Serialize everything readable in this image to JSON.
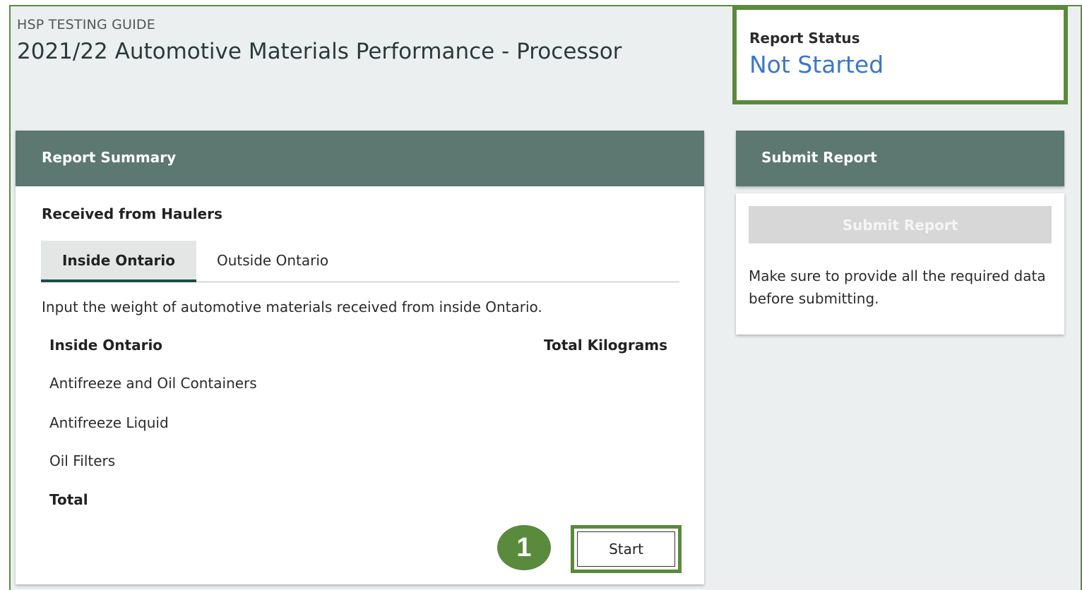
{
  "header": {
    "guide_label": "HSP TESTING GUIDE",
    "title": "2021/22 Automotive Materials Performance - Processor"
  },
  "status": {
    "label": "Report Status",
    "value": "Not Started",
    "value_color": "#3b77c7"
  },
  "report_summary": {
    "header": "Report Summary",
    "section_title": "Received from Haulers",
    "tabs": [
      {
        "label": "Inside Ontario",
        "active": true
      },
      {
        "label": "Outside Ontario",
        "active": false
      }
    ],
    "instruction": "Input the weight of automotive materials received from inside Ontario.",
    "table": {
      "col_category": "Inside Ontario",
      "col_weight": "Total Kilograms",
      "rows": [
        "Antifreeze and Oil Containers",
        "Antifreeze Liquid",
        "Oil Filters"
      ],
      "total_label": "Total"
    },
    "start_button": "Start",
    "step_number": "1"
  },
  "submit_report": {
    "header": "Submit Report",
    "button": "Submit Report",
    "note": "Make sure to provide all the required data before submitting."
  },
  "colors": {
    "highlight": "#5a8a3c",
    "panel_header": "#5c7870",
    "background": "#eceff0"
  }
}
